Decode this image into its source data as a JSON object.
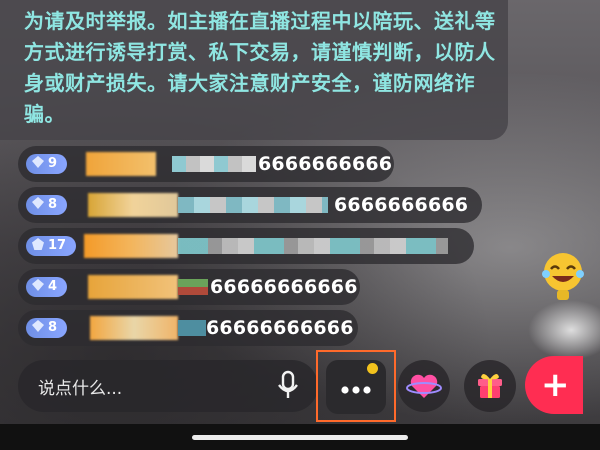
{
  "notice": {
    "text": "为请及时举报。如主播在直播过程中以陪玩、送礼等方式进行诱导打赏、私下交易，请谨慎判断，以防人身或财产损失。请大家注意财产安全，谨防网络诈骗。"
  },
  "comments": [
    {
      "level": "9",
      "message": "6666666666"
    },
    {
      "level": "8",
      "message": "6666666666"
    },
    {
      "level": "17",
      "message": ""
    },
    {
      "level": "4",
      "message": "66666666666"
    },
    {
      "level": "8",
      "message": "66666666666"
    }
  ],
  "input": {
    "placeholder": "说点什么..."
  },
  "icons": {
    "mic": "microphone-icon",
    "more": "more-options-icon",
    "heart": "heart-planet-icon",
    "gift": "gift-icon",
    "plus": "plus-icon"
  },
  "colors": {
    "notice_text": "#8fe6e2",
    "highlight_frame": "#ff6a2b",
    "plus_button": "#ff2d52",
    "badge_dot": "#f2c21d"
  },
  "buttons": {
    "plus_label": "+"
  }
}
